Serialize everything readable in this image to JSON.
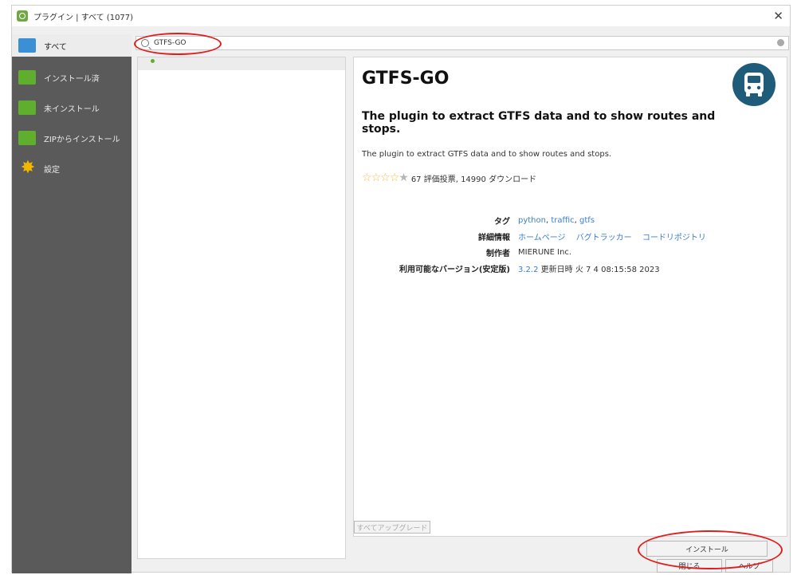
{
  "window": {
    "title": "プラグイン | すべて (1077)"
  },
  "sidebar": {
    "items": [
      {
        "label": "すべて",
        "icon": "puzzle-multicolor-icon",
        "active": true
      },
      {
        "label": "インストール済",
        "icon": "puzzle-green-icon"
      },
      {
        "label": "未インストール",
        "icon": "puzzle-green-icon"
      },
      {
        "label": "ZIPからインストール",
        "icon": "puzzle-green-icon"
      },
      {
        "label": "設定",
        "icon": "gear-icon"
      }
    ]
  },
  "search": {
    "value": "GTFS-GO"
  },
  "plugin": {
    "name": "GTFS-GO",
    "subtitle": "The plugin to extract GTFS data and to show routes and stops.",
    "description": "The plugin to extract GTFS data and to show routes and stops.",
    "rating_stars": 4,
    "rating_text": "67 評価投票, 14990 ダウンロード",
    "logo_icon": "bus-icon",
    "meta": {
      "tags_label": "タグ",
      "tags": [
        "python",
        "traffic",
        "gtfs"
      ],
      "info_label": "詳細情報",
      "links": [
        "ホームページ",
        "バグトラッカー",
        "コードリポジトリ"
      ],
      "author_label": "制作者",
      "author": "MIERUNE Inc.",
      "version_label": "利用可能なバージョン(安定版)",
      "version": "3.2.2",
      "updated_text": "更新日時 火 7 4 08:15:58 2023"
    }
  },
  "buttons": {
    "upgrade_all": "すべてアップグレード",
    "install": "インストール",
    "close": "閉じる",
    "help": "ヘルプ"
  },
  "colors": {
    "sidebar_bg": "#5a5a5a",
    "link": "#3a7fd0",
    "annotation": "#e01e1e",
    "logo_bg": "#1e5c7a"
  }
}
